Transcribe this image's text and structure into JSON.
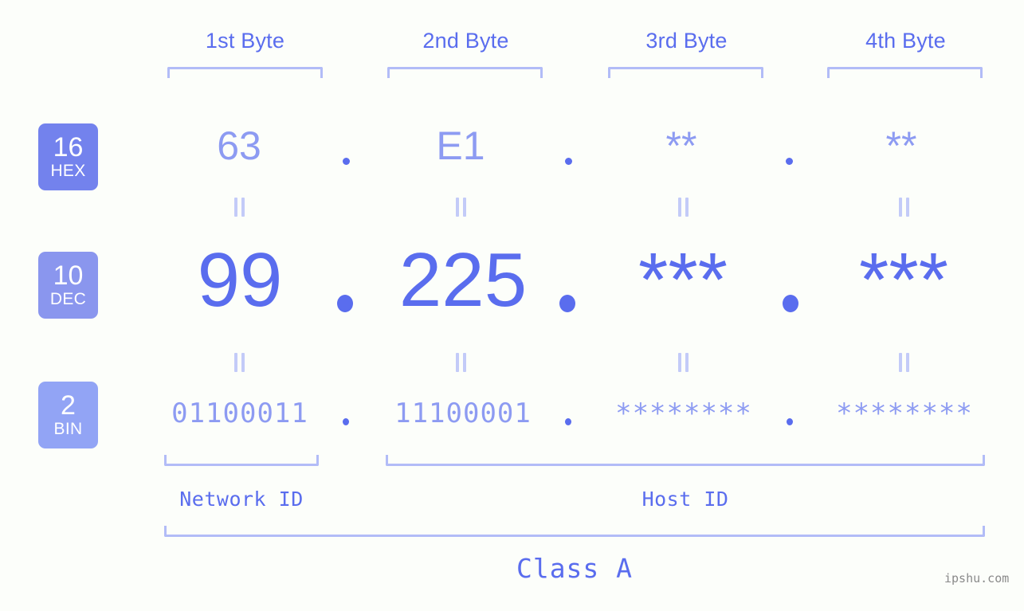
{
  "diagram": {
    "title": "IP address byte breakdown",
    "accent_color": "#5a6dee",
    "light_accent_color": "#8d9bf2",
    "bracket_color": "#b2bcf7",
    "background_color": "#fcfefa",
    "watermark": "ipshu.com"
  },
  "columns": [
    {
      "header": "1st Byte"
    },
    {
      "header": "2nd Byte"
    },
    {
      "header": "3rd Byte"
    },
    {
      "header": "4th Byte"
    }
  ],
  "bases": [
    {
      "number": "16",
      "name": "HEX",
      "color": "#7382ed"
    },
    {
      "number": "10",
      "name": "DEC",
      "color": "#8a96ee"
    },
    {
      "number": "2",
      "name": "BIN",
      "color": "#92a4f5"
    }
  ],
  "rows": {
    "hex": {
      "label_number": "16",
      "label_name": "HEX",
      "values": [
        "63",
        "E1",
        "**",
        "**"
      ]
    },
    "dec": {
      "label_number": "10",
      "label_name": "DEC",
      "values": [
        "99",
        "225",
        "***",
        "***"
      ]
    },
    "bin": {
      "label_number": "2",
      "label_name": "BIN",
      "values": [
        "01100011",
        "11100001",
        "********",
        "********"
      ]
    }
  },
  "separator": ".",
  "equals_glyph": "=",
  "footer": {
    "network_id": "Network ID",
    "host_id": "Host ID",
    "class": "Class A"
  }
}
